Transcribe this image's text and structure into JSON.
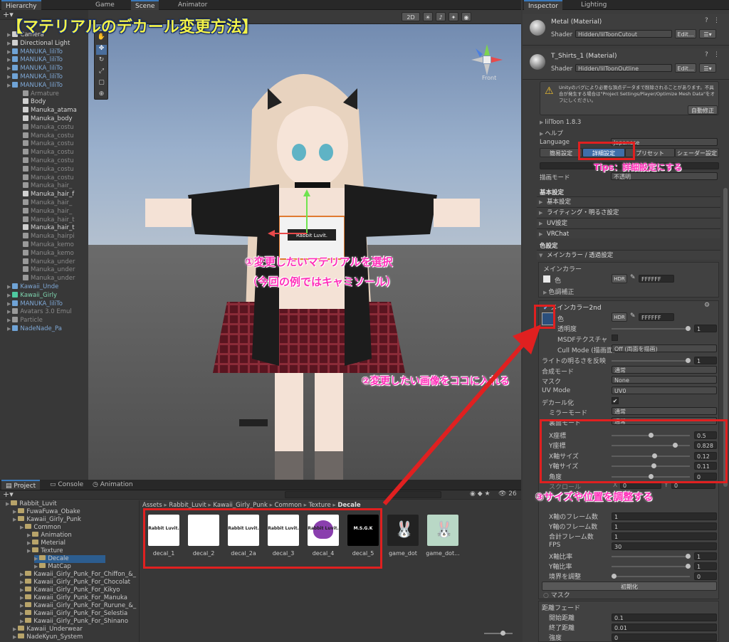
{
  "hierarchy": {
    "tab": "Hierarchy",
    "items": [
      {
        "label": "Camera",
        "indent": 1,
        "kind": "w"
      },
      {
        "label": "Directional Light",
        "indent": 1,
        "kind": "w"
      },
      {
        "label": "MANUKA_liliTo",
        "indent": 1,
        "kind": "b"
      },
      {
        "label": "MANUKA_liliTo",
        "indent": 1,
        "kind": "b"
      },
      {
        "label": "MANUKA_liliTo",
        "indent": 1,
        "kind": "b"
      },
      {
        "label": "MANUKA_liliTo",
        "indent": 1,
        "kind": "b"
      },
      {
        "label": "MANUKA_liliTo",
        "indent": 1,
        "kind": "b"
      },
      {
        "label": "Armature",
        "indent": 2,
        "kind": "g"
      },
      {
        "label": "Body",
        "indent": 2,
        "kind": "w"
      },
      {
        "label": "Manuka_atama",
        "indent": 2,
        "kind": "w"
      },
      {
        "label": "Manuka_body",
        "indent": 2,
        "kind": "w"
      },
      {
        "label": "Manuka_costu",
        "indent": 2,
        "kind": "g"
      },
      {
        "label": "Manuka_costu",
        "indent": 2,
        "kind": "g"
      },
      {
        "label": "Manuka_costu",
        "indent": 2,
        "kind": "g"
      },
      {
        "label": "Manuka_costu",
        "indent": 2,
        "kind": "g"
      },
      {
        "label": "Manuka_costu",
        "indent": 2,
        "kind": "g"
      },
      {
        "label": "Manuka_costu",
        "indent": 2,
        "kind": "g"
      },
      {
        "label": "Manuka_costu",
        "indent": 2,
        "kind": "g"
      },
      {
        "label": "Manuka_hair_",
        "indent": 2,
        "kind": "g"
      },
      {
        "label": "Manuka_hair_f",
        "indent": 2,
        "kind": "w"
      },
      {
        "label": "Manuka_hair_",
        "indent": 2,
        "kind": "g"
      },
      {
        "label": "Manuka_hair_",
        "indent": 2,
        "kind": "g"
      },
      {
        "label": "Manuka_hair_t",
        "indent": 2,
        "kind": "g"
      },
      {
        "label": "Manuka_hair_t",
        "indent": 2,
        "kind": "w"
      },
      {
        "label": "Manuka_hairpi",
        "indent": 2,
        "kind": "g"
      },
      {
        "label": "Manuka_kemo",
        "indent": 2,
        "kind": "g"
      },
      {
        "label": "Manuka_kemo",
        "indent": 2,
        "kind": "g"
      },
      {
        "label": "Manuka_under",
        "indent": 2,
        "kind": "g"
      },
      {
        "label": "Manuka_under",
        "indent": 2,
        "kind": "g"
      },
      {
        "label": "Manuka_under",
        "indent": 2,
        "kind": "g"
      },
      {
        "label": "Kawaii_Unde",
        "indent": 1,
        "kind": "b"
      },
      {
        "label": "Kawaii_Girly",
        "indent": 1,
        "kind": "c"
      },
      {
        "label": "MANUKA_liliTo",
        "indent": 1,
        "kind": "b"
      },
      {
        "label": "Avatars 3.0 Emul",
        "indent": 1,
        "kind": "g"
      },
      {
        "label": "Particle",
        "indent": 1,
        "kind": "g"
      },
      {
        "label": "NadeNade_Pa",
        "indent": 1,
        "kind": "b"
      }
    ]
  },
  "scene": {
    "tabs": [
      "Game",
      "Scene",
      "Animator"
    ],
    "toolbar_2d": "2D",
    "front_label": "Front",
    "shirt_text": "Rabbit Luvit."
  },
  "inspector": {
    "tabs": [
      "Inspector",
      "Lighting"
    ],
    "materials": [
      {
        "name": "Metal (Material)",
        "shader_label": "Shader",
        "shader": "Hidden/lilToonCutout",
        "edit": "Edit..."
      },
      {
        "name": "T_Shirts_1 (Material)",
        "shader_label": "Shader",
        "shader": "Hidden/lilToonOutline",
        "edit": "Edit..."
      }
    ],
    "warning": "Unityのバグにより必要な頂点データまで削除されることがあります。不具合が発生する場合は\"Project Settings/Player/Optimize Mesh Data\"をオフにしください。",
    "fix_button": "自動修正",
    "version": "lilToon 1.8.3",
    "help": "ヘルプ",
    "language_label": "Language",
    "language_value": "Japanese",
    "mode_buttons": [
      "簡易設定",
      "詳細設定",
      "プリセット",
      "シェーダー設定"
    ],
    "render_mode_label": "描画モード",
    "render_mode_value": "不透明",
    "basic_header": "基本設定",
    "groups": [
      "基本設定",
      "ライティング・明るさ設定",
      "UV設定",
      "VRChat"
    ],
    "color_header": "色設定",
    "main_color_group": "メインカラー / 透過設定",
    "main_color": "メインカラー",
    "color_label": "色",
    "hdr": "HDR",
    "hex": "FFFFFF",
    "tone": "色調補正",
    "main2": "メインカラー2nd",
    "transparency": "透明度",
    "transparency_val": "1",
    "msdf": "MSDFテクスチャ",
    "cull_label": "Cull Mode (描画面)",
    "cull_value": "Off (両面を描画)",
    "light_label": "ライトの明るさを反映",
    "light_val": "1",
    "blend_label": "合成モード",
    "blend_val": "通常",
    "mask_label": "マスク",
    "mask_val": "None",
    "uv_label": "UV Mode",
    "uv_val": "UV0",
    "decal_label": "デカール化",
    "mirror_label": "ミラーモード",
    "mirror_val": "通常",
    "both_label": "裏面モード",
    "both_val": "通常",
    "params": [
      {
        "label": "X座標",
        "value": "0.5",
        "pos": 0.5
      },
      {
        "label": "Y座標",
        "value": "0.828",
        "pos": 0.828
      },
      {
        "label": "X軸サイズ",
        "value": "0.12",
        "pos": 0.55
      },
      {
        "label": "Y軸サイズ",
        "value": "0.11",
        "pos": 0.54
      },
      {
        "label": "角度",
        "value": "0",
        "pos": 0.5
      }
    ],
    "scroll_label": "スクロール",
    "scroll_x": "X",
    "scroll_x_val": "0",
    "scroll_y": "Y",
    "scroll_y_val": "0",
    "anim": [
      {
        "label": "X軸のフレーム数",
        "value": "1"
      },
      {
        "label": "Y軸のフレーム数",
        "value": "1"
      },
      {
        "label": "合計フレーム数",
        "value": "1"
      },
      {
        "label": "FPS",
        "value": "30"
      }
    ],
    "ratio": [
      {
        "label": "X軸比率",
        "value": "1"
      },
      {
        "label": "Y軸比率",
        "value": "1"
      },
      {
        "label": "境界を調整",
        "value": "0"
      }
    ],
    "init_button": "初期化",
    "mask2": "マスク",
    "fade_label": "距離フェード",
    "fade": [
      {
        "label": "開始距離",
        "value": "0.1"
      },
      {
        "label": "終了距離",
        "value": "0.01"
      },
      {
        "label": "強度",
        "value": "0"
      }
    ]
  },
  "project": {
    "tabs": [
      "Project",
      "Console",
      "Animation"
    ],
    "breadcrumb": [
      "Assets",
      "Rabbit_Luvit",
      "Kawaii_Girly_Punk",
      "Common",
      "Texture",
      "Decale"
    ],
    "count": "26",
    "tree": [
      {
        "label": "Rabbit_Luvit",
        "indent": 0
      },
      {
        "label": "FuwaFuwa_Obake",
        "indent": 1
      },
      {
        "label": "Kawaii_Girly_Punk",
        "indent": 1
      },
      {
        "label": "Common",
        "indent": 2
      },
      {
        "label": "Animation",
        "indent": 3
      },
      {
        "label": "Meterial",
        "indent": 3
      },
      {
        "label": "Texture",
        "indent": 3
      },
      {
        "label": "Decale",
        "indent": 4
      },
      {
        "label": "MatCap",
        "indent": 4
      },
      {
        "label": "Kawaii_Girly_Punk_For_Chiffon_&_",
        "indent": 2
      },
      {
        "label": "Kawaii_Girly_Punk_For_Chocolat",
        "indent": 2
      },
      {
        "label": "Kawaii_Girly_Punk_For_Kikyo",
        "indent": 2
      },
      {
        "label": "Kawaii_Girly_Punk_For_Manuka",
        "indent": 2
      },
      {
        "label": "Kawaii_Girly_Punk_For_Rurune_&_",
        "indent": 2
      },
      {
        "label": "Kawaii_Girly_Punk_For_Selestia",
        "indent": 2
      },
      {
        "label": "Kawaii_Girly_Punk_For_Shinano",
        "indent": 2
      },
      {
        "label": "Kawaii_Underwear",
        "indent": 1
      },
      {
        "label": "NadeKyun_System",
        "indent": 1
      }
    ],
    "assets": [
      "decal_1",
      "decal_2",
      "decal_2a",
      "decal_3",
      "decal_4",
      "decal_5",
      "game_dot",
      "game_dot..."
    ],
    "asset_texts": [
      "Rabbit Luvit.",
      "",
      "Rabbit Luvit.",
      "Rabbit Luvit.",
      "Rabbit Luvit.",
      "M.S.G.K",
      "",
      ""
    ]
  },
  "annotations": {
    "title": "【マテリアルのデカール変更方法】",
    "step1a": "①変更したいマテリアルを選択",
    "step1b": "（今回の例ではキャミソール）",
    "step2": "②変更したい画像をココに入れる",
    "step3": "③サイズや位置を調整する",
    "tips": "Tips：詳細設定にする"
  },
  "colors": {
    "accent": "#3a79bb",
    "annotation_red": "#e02020",
    "magenta": "#ff2fb9"
  }
}
